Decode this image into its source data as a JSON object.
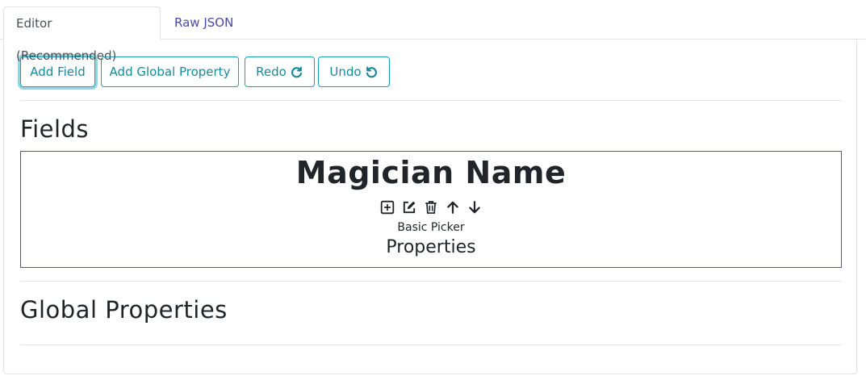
{
  "tabs": [
    {
      "label": "Editor (Recommended)",
      "active": true
    },
    {
      "label": "Raw JSON",
      "active": false
    }
  ],
  "toolbar": {
    "add_field": "Add Field",
    "add_global_property": "Add Global Property",
    "redo": "Redo",
    "undo": "Undo"
  },
  "fields_section": {
    "title": "Fields",
    "items": [
      {
        "name": "Magician Name",
        "actions": [
          "add-icon",
          "edit-icon",
          "trash-icon",
          "arrow-up-icon",
          "arrow-down-icon"
        ],
        "type": "Basic Picker",
        "properties_label": "Properties"
      }
    ]
  },
  "global_section": {
    "title": "Global Properties"
  },
  "colors": {
    "accent": "#17a2b8",
    "tab_inactive": "#4a4aa6",
    "field_border": "#5a5a78"
  }
}
